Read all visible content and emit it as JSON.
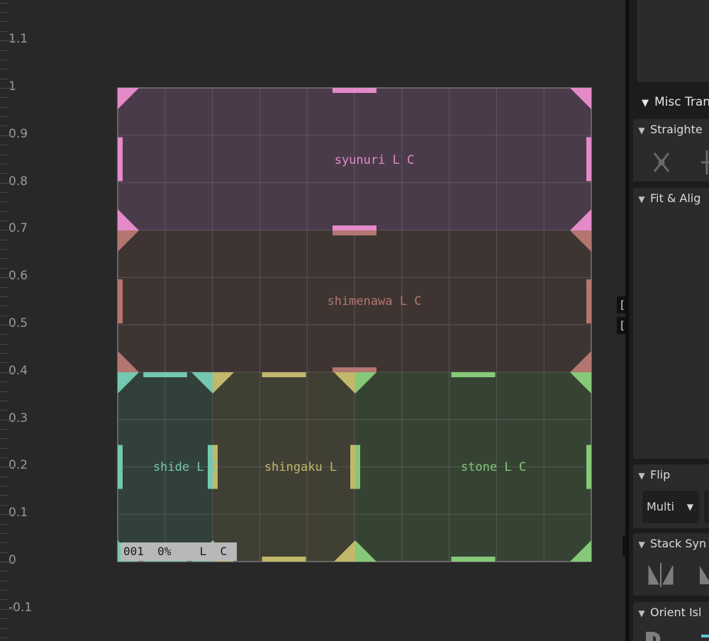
{
  "ruler": {
    "ticks": [
      "1.1",
      "1",
      "0.9",
      "0.8",
      "0.7",
      "0.6",
      "0.5",
      "0.4",
      "0.3",
      "0.2",
      "0.1",
      "0",
      "-0.1"
    ]
  },
  "uv_islands": [
    {
      "id": "syunuri",
      "label": "syunuri  L  C",
      "color": "#e58ac8",
      "fill": "#4a3b4b"
    },
    {
      "id": "shimenawa",
      "label": "shimenawa  L  C",
      "color": "#b37670",
      "fill": "#3e3533"
    },
    {
      "id": "shide",
      "label": "shide  L  C",
      "color": "#74c7b0",
      "fill": "#314039"
    },
    {
      "id": "shingaku",
      "label": "shingaku  L  ",
      "color": "#c2b86c",
      "fill": "#403f34"
    },
    {
      "id": "stone",
      "label": "stone  L  C",
      "color": "#86c978",
      "fill": "#364333"
    }
  ],
  "status": {
    "info": "001  0%",
    "lc": " L  C"
  },
  "side_brackets": [
    "[s",
    "[s"
  ],
  "panel": {
    "misc_title": "Misc Tran",
    "sections": {
      "straighten": "Straighte",
      "fit_align": "Fit & Alig",
      "flip": "Flip",
      "stack": "Stack Syn",
      "orient": "Orient Isl"
    },
    "flip_dropdown": "Multi"
  }
}
